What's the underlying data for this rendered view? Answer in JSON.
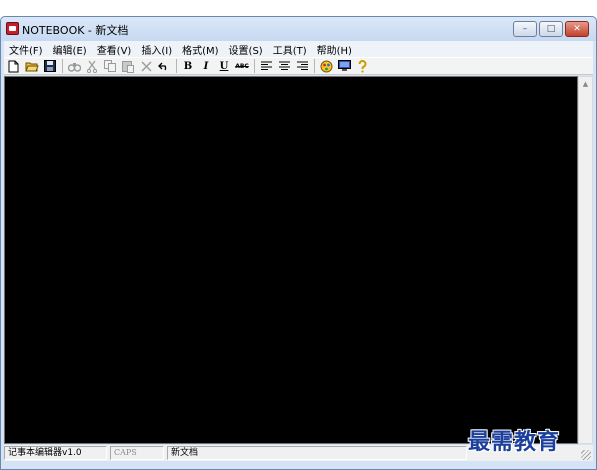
{
  "window": {
    "title": "NOTEBOOK - 新文档",
    "minimize_label": "–",
    "maximize_label": "□",
    "close_label": "✕"
  },
  "menu": {
    "items": [
      {
        "label": "文件(F)"
      },
      {
        "label": "编辑(E)"
      },
      {
        "label": "查看(V)"
      },
      {
        "label": "插入(I)"
      },
      {
        "label": "格式(M)"
      },
      {
        "label": "设置(S)"
      },
      {
        "label": "工具(T)"
      },
      {
        "label": "帮助(H)"
      }
    ]
  },
  "toolbar": {
    "new_icon": "new-document-icon",
    "open_icon": "open-folder-icon",
    "save_icon": "save-disk-icon",
    "find_icon": "find-binoculars-icon",
    "cut_icon": "cut-scissors-icon",
    "copy_icon": "copy-icon",
    "paste_icon": "paste-icon",
    "delete_icon": "delete-x-icon",
    "undo_icon": "undo-icon",
    "bold_label": "B",
    "italic_label": "I",
    "underline_label": "U",
    "strike_label": "ABC",
    "align_left_icon": "align-left-icon",
    "align_center_icon": "align-center-icon",
    "align_right_icon": "align-right-icon",
    "settings_icon": "color-settings-icon",
    "monitor_icon": "monitor-icon",
    "help_icon": "help-question-icon"
  },
  "editor": {
    "content": "",
    "background": "#000000"
  },
  "statusbar": {
    "app_version": "记事本编辑器v1.0",
    "caps": "CAPS",
    "document_name": "新文档"
  },
  "watermark": {
    "text": "最需教育",
    "color": "#1b3f9c"
  }
}
